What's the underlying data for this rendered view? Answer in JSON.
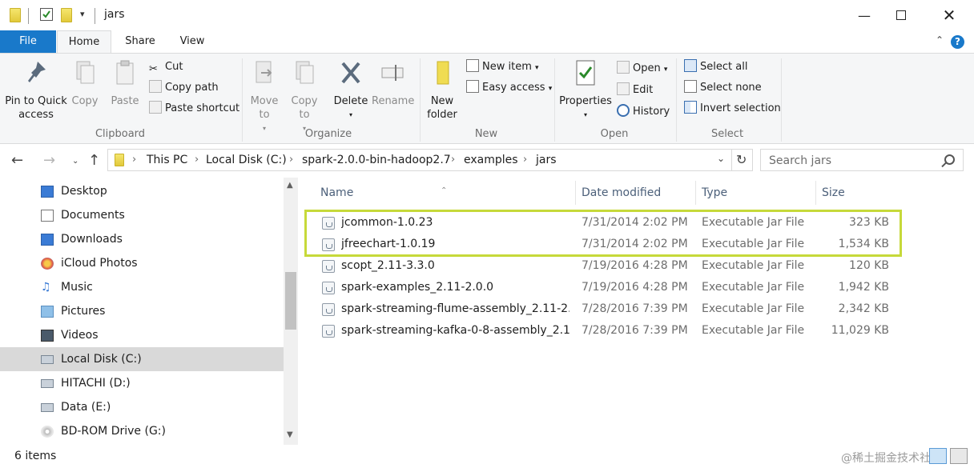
{
  "window": {
    "title": "jars"
  },
  "ribbon_tabs": {
    "file": "File",
    "home": "Home",
    "share": "Share",
    "view": "View"
  },
  "clipboard": {
    "pin": "Pin to Quick access",
    "copy": "Copy",
    "paste": "Paste",
    "cut": "Cut",
    "copy_path": "Copy path",
    "paste_shortcut": "Paste shortcut",
    "group_label": "Clipboard"
  },
  "organize": {
    "move_to": "Move to",
    "copy_to": "Copy to",
    "delete": "Delete",
    "rename": "Rename",
    "group_label": "Organize"
  },
  "new_group": {
    "new_folder": "New folder",
    "new_item": "New item",
    "easy_access": "Easy access",
    "group_label": "New"
  },
  "open_group": {
    "properties": "Properties",
    "open": "Open",
    "edit": "Edit",
    "history": "History",
    "group_label": "Open"
  },
  "select_group": {
    "select_all": "Select all",
    "select_none": "Select none",
    "invert_selection": "Invert selection",
    "group_label": "Select"
  },
  "breadcrumbs": [
    "This PC",
    "Local Disk (C:)",
    "spark-2.0.0-bin-hadoop2.7",
    "examples",
    "jars"
  ],
  "search": {
    "placeholder": "Search jars"
  },
  "nav_items": [
    "Desktop",
    "Documents",
    "Downloads",
    "iCloud Photos",
    "Music",
    "Pictures",
    "Videos",
    "Local Disk (C:)",
    "HITACHI (D:)",
    "Data (E:)",
    "BD-ROM Drive (G:)"
  ],
  "selected_nav": "Local Disk (C:)",
  "columns": {
    "name": "Name",
    "date": "Date modified",
    "type": "Type",
    "size": "Size"
  },
  "files": [
    {
      "name": "jcommon-1.0.23",
      "date": "7/31/2014 2:02 PM",
      "type": "Executable Jar File",
      "size": "323 KB"
    },
    {
      "name": "jfreechart-1.0.19",
      "date": "7/31/2014 2:02 PM",
      "type": "Executable Jar File",
      "size": "1,534 KB"
    },
    {
      "name": "scopt_2.11-3.3.0",
      "date": "7/19/2016 4:28 PM",
      "type": "Executable Jar File",
      "size": "120 KB"
    },
    {
      "name": "spark-examples_2.11-2.0.0",
      "date": "7/19/2016 4:28 PM",
      "type": "Executable Jar File",
      "size": "1,942 KB"
    },
    {
      "name": "spark-streaming-flume-assembly_2.11-2...",
      "date": "7/28/2016 7:39 PM",
      "type": "Executable Jar File",
      "size": "2,342 KB"
    },
    {
      "name": "spark-streaming-kafka-0-8-assembly_2.1...",
      "date": "7/28/2016 7:39 PM",
      "type": "Executable Jar File",
      "size": "11,029 KB"
    }
  ],
  "status": {
    "item_count": "6 items",
    "watermark": "@稀土掘金技术社区"
  },
  "colors": {
    "accent": "#1979ca",
    "highlight": "#c6d93a",
    "selected_nav": "#d9d9d9"
  }
}
